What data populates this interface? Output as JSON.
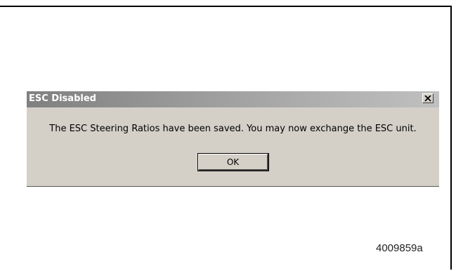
{
  "dialog": {
    "title": "ESC Disabled",
    "message": "The ESC Steering Ratios have been saved.  You may now exchange the ESC unit.",
    "ok_label": "OK",
    "close_icon": "close-icon"
  },
  "figure_id": "4009859a",
  "colors": {
    "dialog_bg": "#d4d0c8",
    "titlebar_start": "#808080",
    "titlebar_end": "#c0c0c0"
  }
}
